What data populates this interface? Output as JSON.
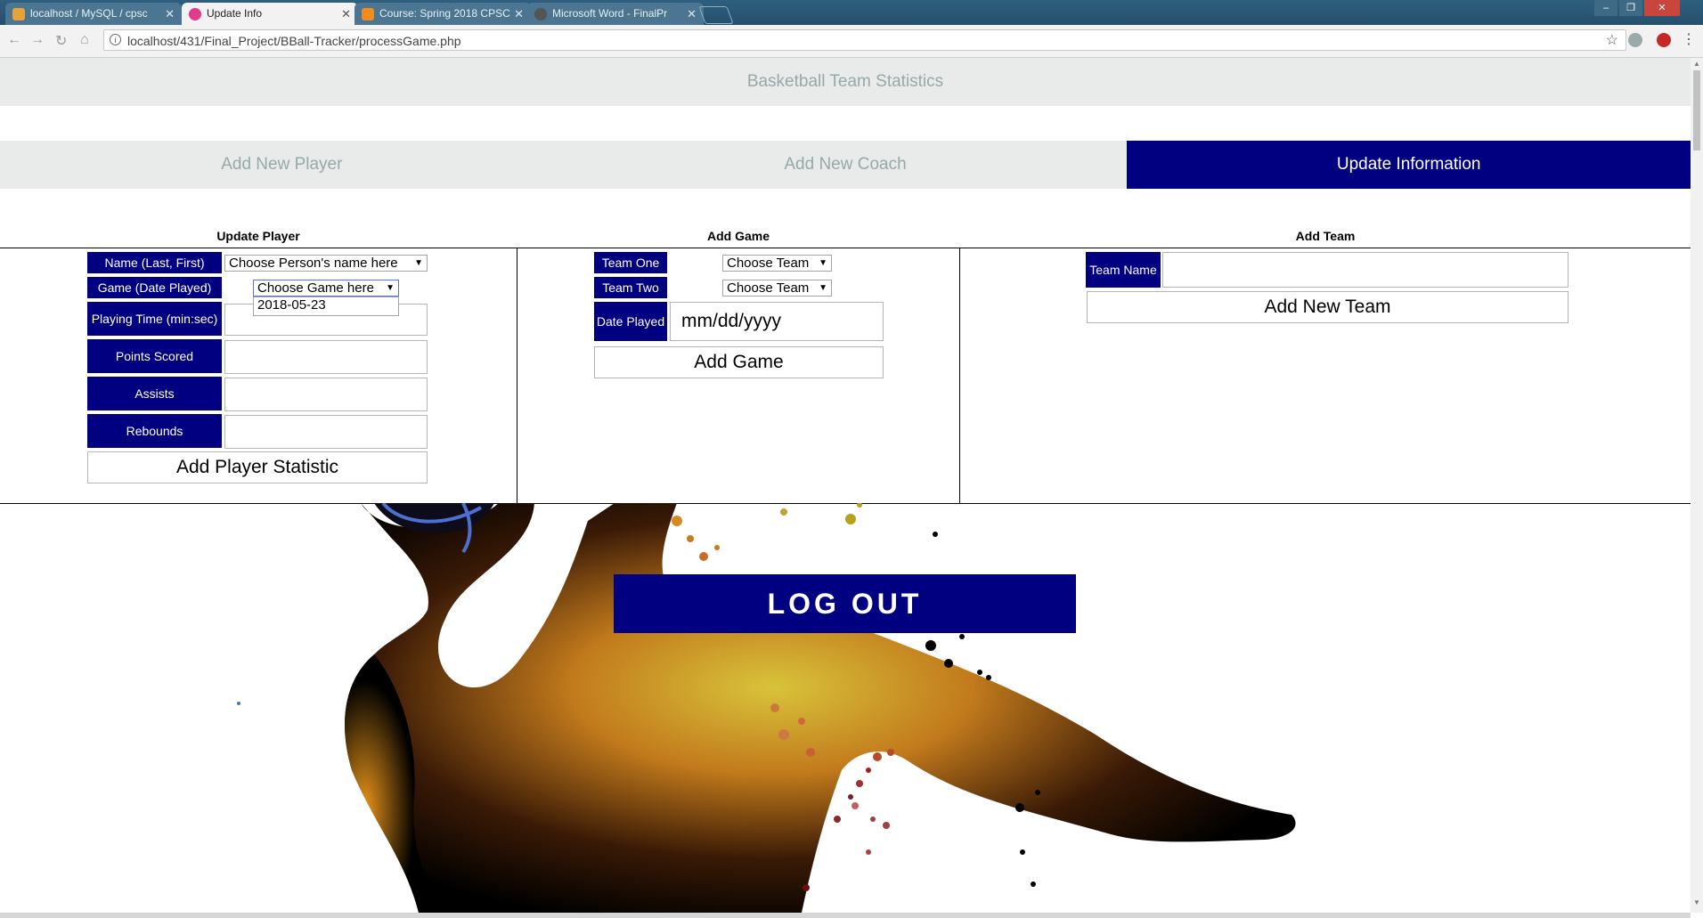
{
  "browser": {
    "tabs": [
      {
        "title": "localhost / MySQL / cpsc",
        "active": false,
        "favicon_color": "#e8a23a"
      },
      {
        "title": "Update Info",
        "active": true,
        "favicon_color": "#e23b8c"
      },
      {
        "title": "Course: Spring 2018 CPSC",
        "active": false,
        "favicon_color": "#f28b1e"
      },
      {
        "title": "Microsoft Word - FinalPr",
        "active": false,
        "favicon_color": "#555555"
      }
    ],
    "close_glyph": "✕",
    "url": "localhost/431/Final_Project/BBall-Tracker/processGame.php",
    "window_controls": {
      "minimize": "–",
      "restore": "❐",
      "close": "✕"
    }
  },
  "page": {
    "header_title": "Basketball Team Statistics",
    "nav": [
      {
        "label": "Add New Player",
        "active": false
      },
      {
        "label": "Add New Coach",
        "active": false
      },
      {
        "label": "Update Information",
        "active": true
      }
    ]
  },
  "update_player": {
    "title": "Update Player",
    "name_label": "Name (Last, First)",
    "name_select": "Choose Person's name here",
    "game_label": "Game (Date Played)",
    "game_select": "Choose Game here",
    "game_option": "2018-05-23",
    "playing_time_label": "Playing Time (min:sec)",
    "points_label": "Points Scored",
    "assists_label": "Assists",
    "rebounds_label": "Rebounds",
    "submit": "Add Player Statistic"
  },
  "add_game": {
    "title": "Add Game",
    "team_one_label": "Team One",
    "team_one_select": "Choose Team",
    "team_two_label": "Team Two",
    "team_two_select": "Choose Team",
    "date_label": "Date Played",
    "date_placeholder": "mm/dd/yyyy",
    "submit": "Add Game"
  },
  "add_team": {
    "title": "Add Team",
    "name_label": "Team Name",
    "submit": "Add New Team"
  },
  "logout": "LOG OUT",
  "colors": {
    "accent": "#000080",
    "header_bg": "#e8ebea",
    "header_text": "#96a9a8"
  }
}
